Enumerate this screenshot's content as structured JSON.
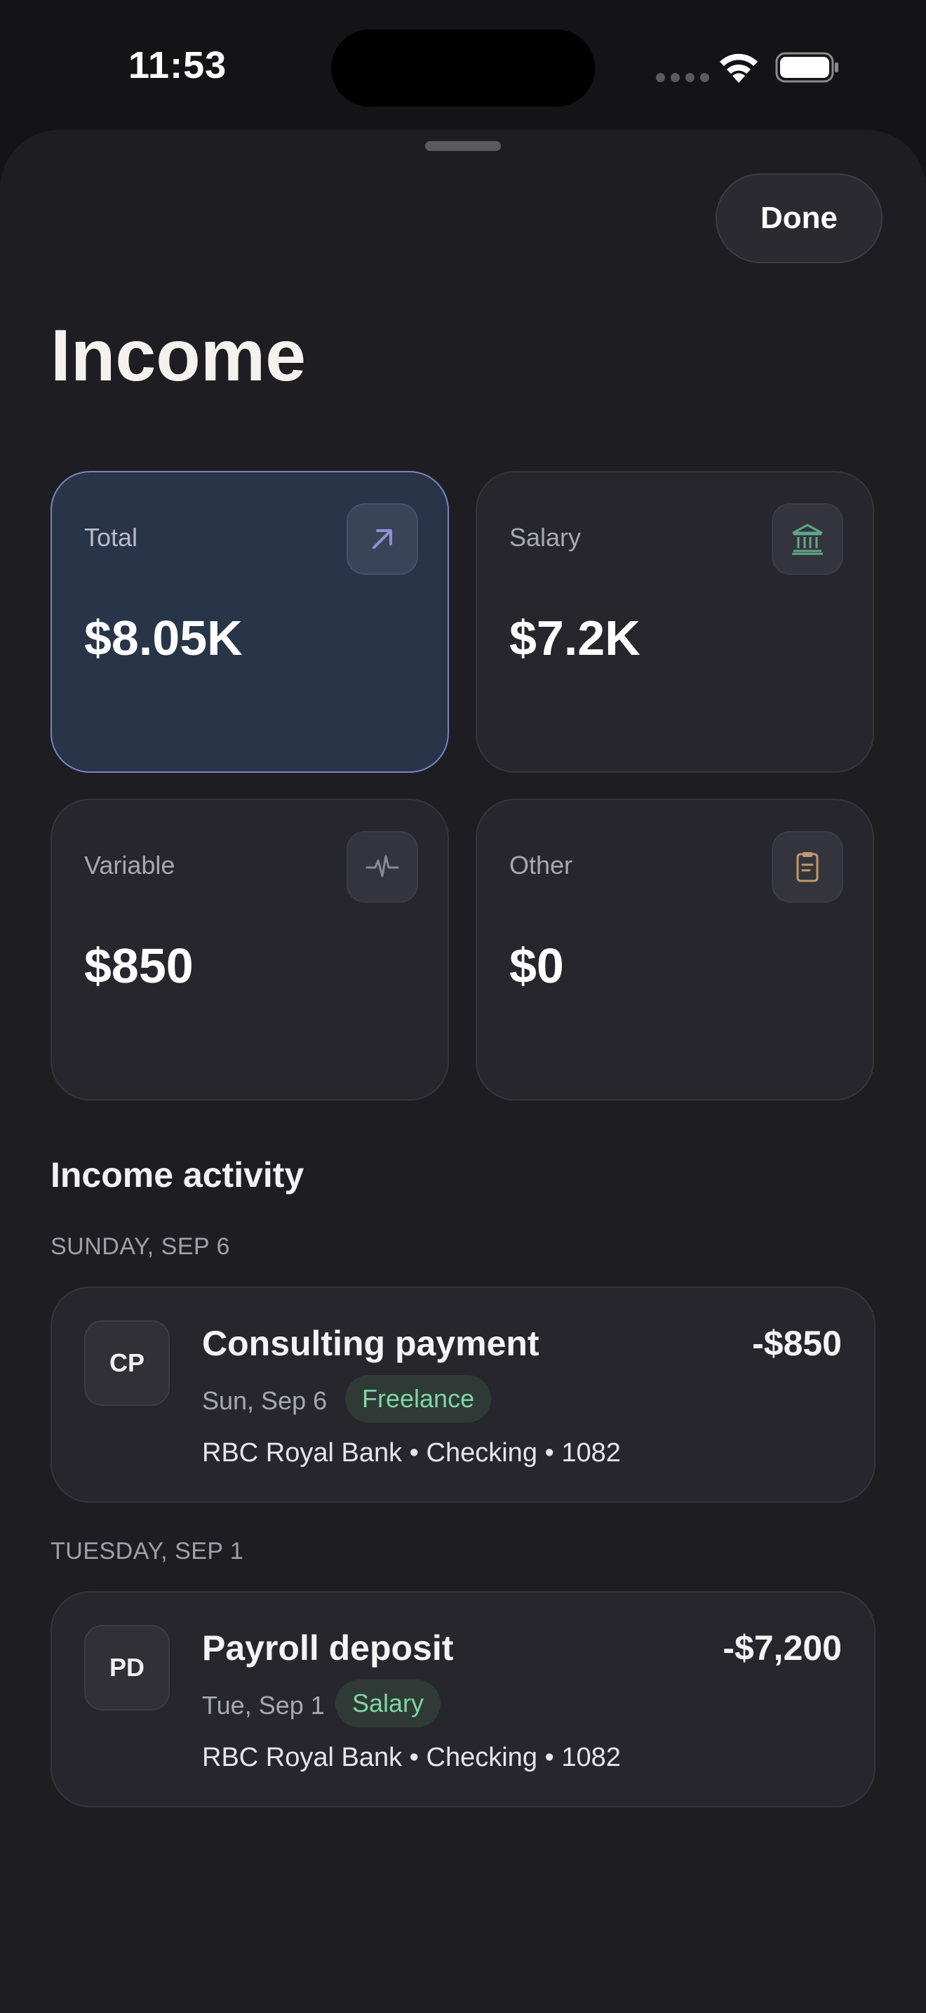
{
  "status_bar": {
    "time": "11:53"
  },
  "sheet": {
    "done_label": "Done",
    "title": "Income"
  },
  "summary_cards": [
    {
      "label": "Total",
      "value": "$8.05K",
      "icon": "arrow-up-right-icon",
      "selected": true
    },
    {
      "label": "Salary",
      "value": "$7.2K",
      "icon": "bank-icon",
      "selected": false
    },
    {
      "label": "Variable",
      "value": "$850",
      "icon": "pulse-icon",
      "selected": false
    },
    {
      "label": "Other",
      "value": "$0",
      "icon": "clipboard-icon",
      "selected": false
    }
  ],
  "activity": {
    "title": "Income activity",
    "groups": [
      {
        "date_header": "SUNDAY, SEP 6",
        "transaction": {
          "initials": "CP",
          "name": "Consulting payment",
          "amount": "-$850",
          "date": "Sun, Sep 6",
          "tag": "Freelance",
          "account": "RBC Royal Bank • Checking • 1082"
        }
      },
      {
        "date_header": "TUESDAY, SEP 1",
        "transaction": {
          "initials": "PD",
          "name": "Payroll deposit",
          "amount": "-$7,200",
          "date": "Tue, Sep 1",
          "tag": "Salary",
          "account": "RBC Royal Bank • Checking • 1082"
        }
      }
    ]
  },
  "colors": {
    "background": "#141417",
    "sheet": "#1e1e22",
    "card": "#26262c",
    "card_selected": "#283448",
    "card_selected_border": "#7a84c2",
    "tag_green_text": "#7fd6a4",
    "tag_green_bg": "#2f3a36"
  }
}
